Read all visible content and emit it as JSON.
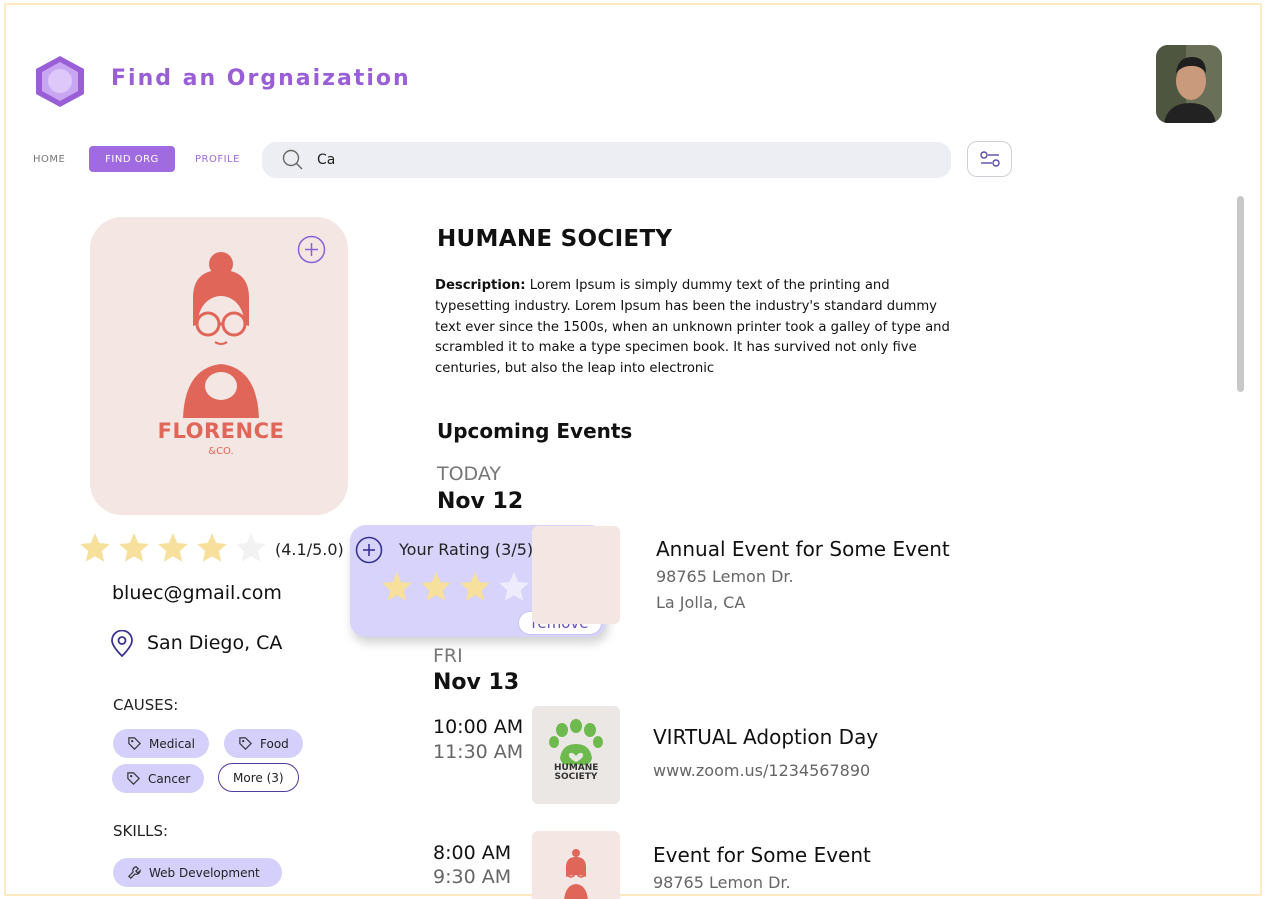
{
  "app": {
    "title": "Find an Orgnaization"
  },
  "nav": {
    "home": "HOME",
    "find_org": "FIND ORG",
    "profile": "PROFILE"
  },
  "search": {
    "value": "Ca",
    "icon": "search-icon"
  },
  "org": {
    "name": "HUMANE SOCIETY",
    "logo_text": "FLORENCE",
    "logo_subtext": "&CO.",
    "description_label": "Description:",
    "description": " Lorem Ipsum is simply dummy text of the printing and typesetting industry. Lorem Ipsum has been the industry's standard dummy text ever since the 1500s, when an unknown printer took a galley of type and scrambled it to make a type specimen book. It has survived not only five centuries, but also the leap into electronic",
    "rating_text": "(4.1/5.0)",
    "rating_value": 4.1,
    "email": "bluec@gmail.com",
    "location": "San Diego, CA",
    "causes_label": "CAUSES:",
    "causes": [
      "Medical",
      "Food",
      "Cancer"
    ],
    "causes_more": "More (3)",
    "skills_label": "SKILLS:",
    "skills": [
      "Web Development"
    ]
  },
  "your_rating": {
    "label": "Your Rating (3/5):",
    "value": 3,
    "remove_label": "remove"
  },
  "events": {
    "title": "Upcoming Events",
    "groups": [
      {
        "day": "TODAY",
        "date": "Nov 12",
        "items": [
          {
            "title": "Annual Event for Some Event",
            "line1": "98765 Lemon Dr.",
            "line2": "La Jolla, CA"
          }
        ]
      },
      {
        "day": "FRI",
        "date": "Nov 13",
        "items": [
          {
            "start": "10:00 AM",
            "end": "11:30 AM",
            "title": "VIRTUAL Adoption Day",
            "line1": "www.zoom.us/1234567890",
            "thumb_text": "HUMANE SOCIETY"
          },
          {
            "start": "8:00 AM",
            "end": "9:30 AM",
            "title": "Event for Some Event",
            "line1": "98765 Lemon Dr."
          }
        ]
      }
    ]
  },
  "colors": {
    "accent": "#a06ae0",
    "star": "#f7df9c",
    "popup": "#d7d3fb",
    "tag": "#d4cffb"
  }
}
